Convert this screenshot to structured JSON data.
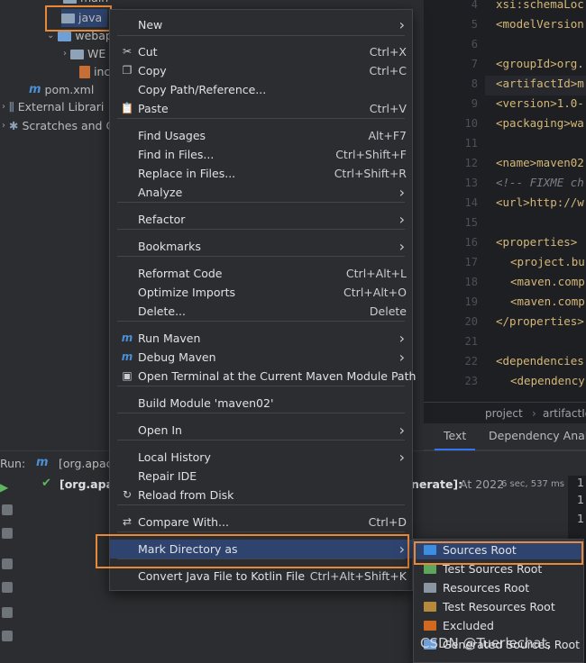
{
  "project_tree": {
    "items": [
      {
        "label": "main",
        "kind": "folder"
      },
      {
        "label": "java",
        "kind": "folder"
      },
      {
        "label": "webap",
        "kind": "folder"
      },
      {
        "label": "WE",
        "kind": "folder"
      },
      {
        "label": "inc",
        "kind": "jsp"
      },
      {
        "label": "pom.xml",
        "kind": "maven"
      },
      {
        "label": "External Librari",
        "kind": "libs"
      },
      {
        "label": "Scratches and C",
        "kind": "scratch"
      }
    ]
  },
  "editor": {
    "lines": [
      {
        "num": "4",
        "text": "xsi:schemaLoc",
        "style": "tag"
      },
      {
        "num": "5",
        "text": "<modelVersion",
        "style": "tag"
      },
      {
        "num": "6",
        "text": "",
        "style": "tag"
      },
      {
        "num": "7",
        "text": "<groupId>org.",
        "style": "tag"
      },
      {
        "num": "8",
        "text": "<artifactId>m",
        "style": "tag"
      },
      {
        "num": "9",
        "text": "<version>1.0-",
        "style": "tag"
      },
      {
        "num": "10",
        "text": "<packaging>wa",
        "style": "tag"
      },
      {
        "num": "11",
        "text": "",
        "style": "tag"
      },
      {
        "num": "12",
        "text": "<name>maven02",
        "style": "tag"
      },
      {
        "num": "13",
        "text": "<!-- FIXME ch",
        "style": "comment"
      },
      {
        "num": "14",
        "text": "<url>http://w",
        "style": "tag"
      },
      {
        "num": "15",
        "text": "",
        "style": "tag"
      },
      {
        "num": "16",
        "text": "<properties>",
        "style": "tag"
      },
      {
        "num": "17",
        "text": "<project.bu",
        "style": "tag"
      },
      {
        "num": "18",
        "text": "<maven.comp",
        "style": "tag"
      },
      {
        "num": "19",
        "text": "<maven.comp",
        "style": "tag"
      },
      {
        "num": "20",
        "text": "</properties>",
        "style": "tag"
      },
      {
        "num": "21",
        "text": "",
        "style": "tag"
      },
      {
        "num": "22",
        "text": "<dependencies",
        "style": "tag"
      },
      {
        "num": "23",
        "text": "<dependency",
        "style": "tag"
      }
    ],
    "breadcrumb": [
      "project",
      "artifactId"
    ],
    "bottom_tabs": [
      "Text",
      "Dependency Analy"
    ]
  },
  "run": {
    "label": "Run:",
    "tab_label": "[org.apac",
    "tree_item": "[org.apac",
    "message": "nerate]:",
    "timing": "At 2022",
    "duration": "6 sec, 537 ms"
  },
  "context_menu": {
    "items": [
      {
        "label": "New",
        "shortcut": "",
        "submenu": true,
        "icon": ""
      },
      {
        "label": "Cut",
        "shortcut": "Ctrl+X",
        "submenu": false,
        "icon": "scissors-icon"
      },
      {
        "label": "Copy",
        "shortcut": "Ctrl+C",
        "submenu": false,
        "icon": "copy-icon"
      },
      {
        "label": "Copy Path/Reference...",
        "shortcut": "",
        "submenu": false,
        "icon": ""
      },
      {
        "label": "Paste",
        "shortcut": "Ctrl+V",
        "submenu": false,
        "icon": "paste-icon"
      },
      {
        "label": "Find Usages",
        "shortcut": "Alt+F7",
        "submenu": false,
        "icon": ""
      },
      {
        "label": "Find in Files...",
        "shortcut": "Ctrl+Shift+F",
        "submenu": false,
        "icon": ""
      },
      {
        "label": "Replace in Files...",
        "shortcut": "Ctrl+Shift+R",
        "submenu": false,
        "icon": ""
      },
      {
        "label": "Analyze",
        "shortcut": "",
        "submenu": true,
        "icon": ""
      },
      {
        "label": "Refactor",
        "shortcut": "",
        "submenu": true,
        "icon": ""
      },
      {
        "label": "Bookmarks",
        "shortcut": "",
        "submenu": true,
        "icon": ""
      },
      {
        "label": "Reformat Code",
        "shortcut": "Ctrl+Alt+L",
        "submenu": false,
        "icon": ""
      },
      {
        "label": "Optimize Imports",
        "shortcut": "Ctrl+Alt+O",
        "submenu": false,
        "icon": ""
      },
      {
        "label": "Delete...",
        "shortcut": "Delete",
        "submenu": false,
        "icon": ""
      },
      {
        "label": "Run Maven",
        "shortcut": "",
        "submenu": true,
        "icon": "maven-icon"
      },
      {
        "label": "Debug Maven",
        "shortcut": "",
        "submenu": true,
        "icon": "maven-debug-icon"
      },
      {
        "label": "Open Terminal at the Current Maven Module Path",
        "shortcut": "",
        "submenu": false,
        "icon": "terminal-icon"
      },
      {
        "label": "Build Module 'maven02'",
        "shortcut": "",
        "submenu": false,
        "icon": ""
      },
      {
        "label": "Open In",
        "shortcut": "",
        "submenu": true,
        "icon": ""
      },
      {
        "label": "Local History",
        "shortcut": "",
        "submenu": true,
        "icon": ""
      },
      {
        "label": "Repair IDE",
        "shortcut": "",
        "submenu": false,
        "icon": ""
      },
      {
        "label": "Reload from Disk",
        "shortcut": "",
        "submenu": false,
        "icon": "reload-icon"
      },
      {
        "label": "Compare With...",
        "shortcut": "Ctrl+D",
        "submenu": false,
        "icon": "compare-icon"
      },
      {
        "label": "Mark Directory as",
        "shortcut": "",
        "submenu": true,
        "icon": ""
      },
      {
        "label": "Convert Java File to Kotlin File",
        "shortcut": "Ctrl+Alt+Shift+K",
        "submenu": false,
        "icon": ""
      }
    ],
    "selected": "Mark Directory as"
  },
  "mark_submenu": {
    "items": [
      {
        "label": "Sources Root",
        "color": "#3d8ee0"
      },
      {
        "label": "Test Sources Root",
        "color": "#5ea55e"
      },
      {
        "label": "Resources Root",
        "color": "#8b96a3"
      },
      {
        "label": "Test Resources Root",
        "color": "#b58a3c"
      },
      {
        "label": "Excluded",
        "color": "#d2691e"
      },
      {
        "label": "Generated Sources Root",
        "color": "#6e9fd6"
      }
    ],
    "selected": "Sources Root"
  },
  "watermark": "CSDN @Tuerlechat,"
}
